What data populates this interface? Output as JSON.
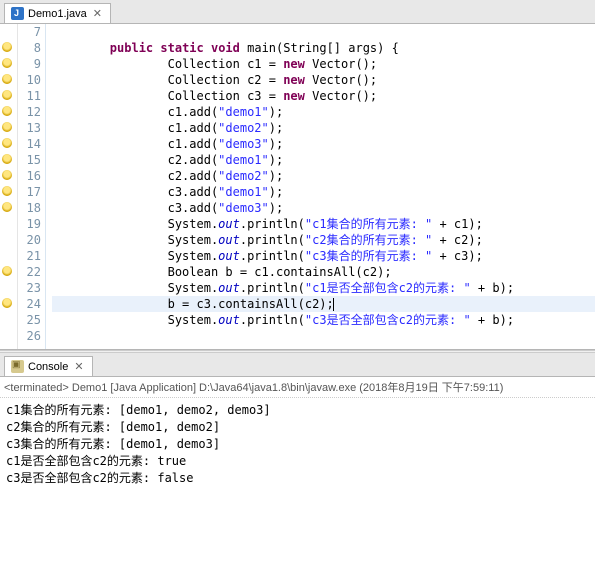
{
  "tab": {
    "filename": "Demo1.java"
  },
  "lines": [
    {
      "num": 7,
      "warn": false,
      "tokens": []
    },
    {
      "num": 8,
      "warn": true,
      "ind": 2,
      "tokens": [
        {
          "t": "kw",
          "v": "public"
        },
        {
          "t": "p",
          "v": " "
        },
        {
          "t": "kw",
          "v": "static"
        },
        {
          "t": "p",
          "v": " "
        },
        {
          "t": "kw",
          "v": "void"
        },
        {
          "t": "p",
          "v": " main(String[] args) {"
        }
      ]
    },
    {
      "num": 9,
      "warn": true,
      "ind": 4,
      "tokens": [
        {
          "t": "p",
          "v": "Collection c1 = "
        },
        {
          "t": "kw",
          "v": "new"
        },
        {
          "t": "p",
          "v": " Vector();"
        }
      ]
    },
    {
      "num": 10,
      "warn": true,
      "ind": 4,
      "tokens": [
        {
          "t": "p",
          "v": "Collection c2 = "
        },
        {
          "t": "kw",
          "v": "new"
        },
        {
          "t": "p",
          "v": " Vector();"
        }
      ]
    },
    {
      "num": 11,
      "warn": true,
      "ind": 4,
      "tokens": [
        {
          "t": "p",
          "v": "Collection c3 = "
        },
        {
          "t": "kw",
          "v": "new"
        },
        {
          "t": "p",
          "v": " Vector();"
        }
      ]
    },
    {
      "num": 12,
      "warn": true,
      "ind": 4,
      "tokens": [
        {
          "t": "p",
          "v": "c1.add("
        },
        {
          "t": "str",
          "v": "\"demo1\""
        },
        {
          "t": "p",
          "v": ");"
        }
      ]
    },
    {
      "num": 13,
      "warn": true,
      "ind": 4,
      "tokens": [
        {
          "t": "p",
          "v": "c1.add("
        },
        {
          "t": "str",
          "v": "\"demo2\""
        },
        {
          "t": "p",
          "v": ");"
        }
      ]
    },
    {
      "num": 14,
      "warn": true,
      "ind": 4,
      "tokens": [
        {
          "t": "p",
          "v": "c1.add("
        },
        {
          "t": "str",
          "v": "\"demo3\""
        },
        {
          "t": "p",
          "v": ");"
        }
      ]
    },
    {
      "num": 15,
      "warn": true,
      "ind": 4,
      "tokens": [
        {
          "t": "p",
          "v": "c2.add("
        },
        {
          "t": "str",
          "v": "\"demo1\""
        },
        {
          "t": "p",
          "v": ");"
        }
      ]
    },
    {
      "num": 16,
      "warn": true,
      "ind": 4,
      "tokens": [
        {
          "t": "p",
          "v": "c2.add("
        },
        {
          "t": "str",
          "v": "\"demo2\""
        },
        {
          "t": "p",
          "v": ");"
        }
      ]
    },
    {
      "num": 17,
      "warn": true,
      "ind": 4,
      "tokens": [
        {
          "t": "p",
          "v": "c3.add("
        },
        {
          "t": "str",
          "v": "\"demo1\""
        },
        {
          "t": "p",
          "v": ");"
        }
      ]
    },
    {
      "num": 18,
      "warn": true,
      "ind": 4,
      "tokens": [
        {
          "t": "p",
          "v": "c3.add("
        },
        {
          "t": "str",
          "v": "\"demo3\""
        },
        {
          "t": "p",
          "v": ");"
        }
      ]
    },
    {
      "num": 19,
      "warn": false,
      "ind": 4,
      "tokens": [
        {
          "t": "p",
          "v": "System."
        },
        {
          "t": "fld",
          "v": "out"
        },
        {
          "t": "p",
          "v": ".println("
        },
        {
          "t": "str",
          "v": "\"c1集合的所有元素: \""
        },
        {
          "t": "p",
          "v": " + c1);"
        }
      ]
    },
    {
      "num": 20,
      "warn": false,
      "ind": 4,
      "tokens": [
        {
          "t": "p",
          "v": "System."
        },
        {
          "t": "fld",
          "v": "out"
        },
        {
          "t": "p",
          "v": ".println("
        },
        {
          "t": "str",
          "v": "\"c2集合的所有元素: \""
        },
        {
          "t": "p",
          "v": " + c2);"
        }
      ]
    },
    {
      "num": 21,
      "warn": false,
      "ind": 4,
      "tokens": [
        {
          "t": "p",
          "v": "System."
        },
        {
          "t": "fld",
          "v": "out"
        },
        {
          "t": "p",
          "v": ".println("
        },
        {
          "t": "str",
          "v": "\"c3集合的所有元素: \""
        },
        {
          "t": "p",
          "v": " + c3);"
        }
      ]
    },
    {
      "num": 22,
      "warn": true,
      "ind": 4,
      "tokens": [
        {
          "t": "p",
          "v": "Boolean b = c1.containsAll(c2);"
        }
      ]
    },
    {
      "num": 23,
      "warn": false,
      "ind": 4,
      "tokens": [
        {
          "t": "p",
          "v": "System."
        },
        {
          "t": "fld",
          "v": "out"
        },
        {
          "t": "p",
          "v": ".println("
        },
        {
          "t": "str",
          "v": "\"c1是否全部包含c2的元素: \""
        },
        {
          "t": "p",
          "v": " + b);"
        }
      ]
    },
    {
      "num": 24,
      "warn": true,
      "ind": 4,
      "hl": true,
      "caret": true,
      "tokens": [
        {
          "t": "p",
          "v": "b = c3.containsAll(c2);"
        }
      ]
    },
    {
      "num": 25,
      "warn": false,
      "ind": 4,
      "tokens": [
        {
          "t": "p",
          "v": "System."
        },
        {
          "t": "fld",
          "v": "out"
        },
        {
          "t": "p",
          "v": ".println("
        },
        {
          "t": "str",
          "v": "\"c3是否全部包含c2的元素: \""
        },
        {
          "t": "p",
          "v": " + b);"
        }
      ]
    },
    {
      "num": 26,
      "warn": false,
      "tokens": []
    }
  ],
  "console": {
    "title": "Console",
    "header": "<terminated> Demo1 [Java Application] D:\\Java64\\java1.8\\bin\\javaw.exe (2018年8月19日 下午7:59:11)",
    "output": [
      "c1集合的所有元素: [demo1, demo2, demo3]",
      "c2集合的所有元素: [demo1, demo2]",
      "c3集合的所有元素: [demo1, demo3]",
      "c1是否全部包含c2的元素: true",
      "c3是否全部包含c2的元素: false"
    ]
  }
}
